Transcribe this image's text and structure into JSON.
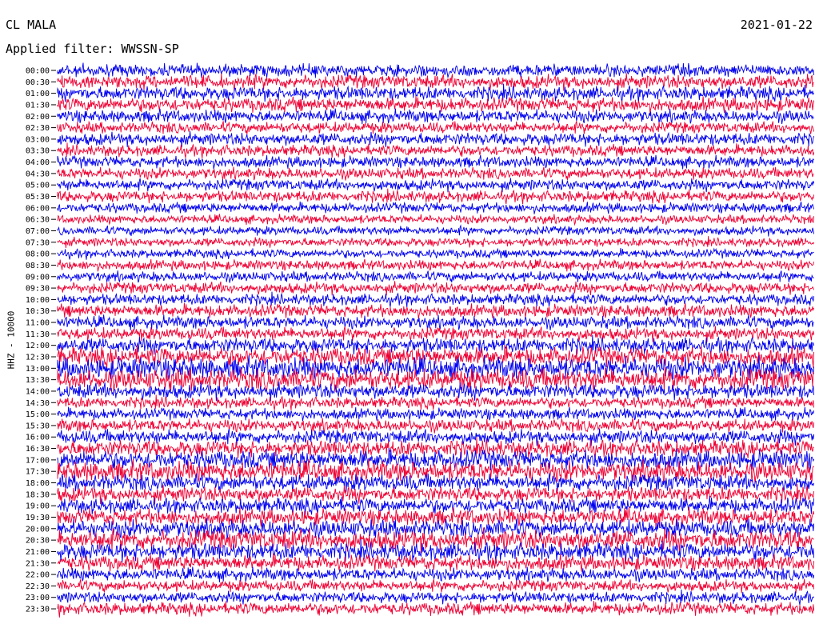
{
  "header": {
    "station": "CL MALA",
    "filter": "Applied filter: WWSSN-SP",
    "date": "2021-01-22",
    "scale_label": "HHZ - 10000"
  },
  "chart_data": {
    "type": "line",
    "title": "CL MALA",
    "subtitle": "Applied filter: WWSSN-SP",
    "ylabel": "HHZ - 10000",
    "xlabel": "",
    "grid": false,
    "legend": "none",
    "row_labels": [
      "00:00",
      "00:30",
      "01:00",
      "01:30",
      "02:00",
      "02:30",
      "03:00",
      "03:30",
      "04:00",
      "04:30",
      "05:00",
      "05:30",
      "06:00",
      "06:30",
      "07:00",
      "07:30",
      "08:00",
      "08:30",
      "09:00",
      "09:30",
      "10:00",
      "10:30",
      "11:00",
      "11:30",
      "12:00",
      "12:30",
      "13:00",
      "13:30",
      "14:00",
      "14:30",
      "15:00",
      "15:30",
      "16:00",
      "16:30",
      "17:00",
      "17:30",
      "18:00",
      "18:30",
      "19:00",
      "19:30",
      "20:00",
      "20:30",
      "21:00",
      "21:30",
      "22:00",
      "22:30",
      "23:00",
      "23:30"
    ],
    "series_colors": [
      "#0000ee",
      "#ee0033"
    ],
    "relative_amplitude": [
      1.0,
      1.1,
      1.1,
      1.1,
      1.0,
      0.9,
      1.0,
      0.9,
      0.9,
      0.9,
      0.9,
      0.9,
      0.8,
      0.7,
      0.7,
      0.7,
      0.7,
      0.8,
      0.8,
      0.9,
      0.9,
      1.0,
      1.0,
      1.0,
      1.2,
      1.5,
      1.7,
      1.7,
      1.2,
      0.9,
      0.9,
      1.0,
      1.1,
      1.3,
      1.5,
      1.6,
      1.3,
      1.2,
      1.2,
      1.3,
      1.4,
      1.6,
      1.4,
      1.2,
      1.0,
      0.9,
      0.9,
      1.0
    ],
    "spike_minutes": [
      208,
      214,
      218,
      224,
      247,
      250,
      279,
      348,
      404,
      611
    ]
  }
}
